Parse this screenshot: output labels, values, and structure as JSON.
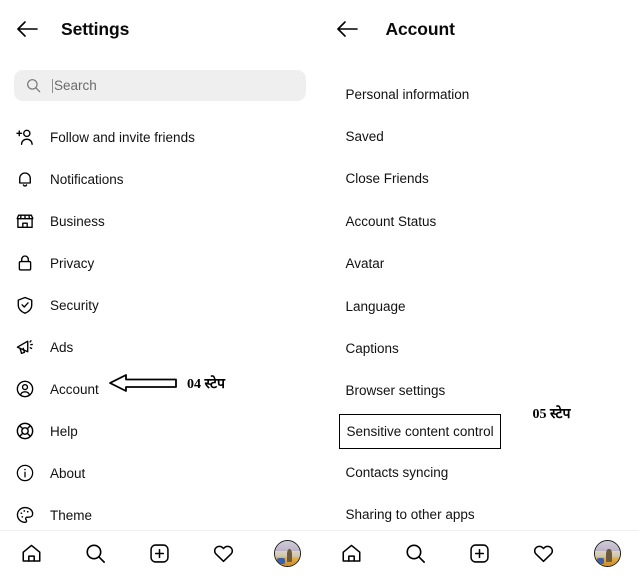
{
  "left_panel": {
    "back_icon": "arrow-left-icon",
    "title": "Settings",
    "search": {
      "icon": "search-icon",
      "placeholder": "Search",
      "value": ""
    },
    "items": [
      {
        "icon": "person-add-icon",
        "label": "Follow and invite friends"
      },
      {
        "icon": "bell-icon",
        "label": "Notifications"
      },
      {
        "icon": "storefront-icon",
        "label": "Business"
      },
      {
        "icon": "lock-icon",
        "label": "Privacy"
      },
      {
        "icon": "shield-check-icon",
        "label": "Security"
      },
      {
        "icon": "megaphone-icon",
        "label": "Ads"
      },
      {
        "icon": "account-circle-icon",
        "label": "Account"
      },
      {
        "icon": "lifebuoy-icon",
        "label": "Help"
      },
      {
        "icon": "info-circle-icon",
        "label": "About"
      },
      {
        "icon": "palette-icon",
        "label": "Theme"
      }
    ],
    "annotation": {
      "icon": "left-arrow-annotation-icon",
      "text": "04 स्टेप"
    }
  },
  "right_panel": {
    "back_icon": "arrow-left-icon",
    "title": "Account",
    "items": [
      {
        "label": "Personal information",
        "highlighted": false
      },
      {
        "label": "Saved",
        "highlighted": false
      },
      {
        "label": "Close Friends",
        "highlighted": false
      },
      {
        "label": "Account Status",
        "highlighted": false
      },
      {
        "label": "Avatar",
        "highlighted": false
      },
      {
        "label": "Language",
        "highlighted": false
      },
      {
        "label": "Captions",
        "highlighted": false
      },
      {
        "label": "Browser settings",
        "highlighted": false
      },
      {
        "label": "Sensitive content control",
        "highlighted": true
      },
      {
        "label": "Contacts syncing",
        "highlighted": false
      },
      {
        "label": "Sharing to other apps",
        "highlighted": false
      }
    ],
    "annotation": {
      "text": "05 स्टेप"
    }
  },
  "bottom_nav": {
    "items": [
      {
        "icon": "home-icon",
        "label": "Home"
      },
      {
        "icon": "search-icon",
        "label": "Search"
      },
      {
        "icon": "plus-square-icon",
        "label": "Create"
      },
      {
        "icon": "heart-icon",
        "label": "Activity"
      },
      {
        "icon": "avatar-icon",
        "label": "Profile"
      }
    ]
  },
  "colors": {
    "background": "#ffffff",
    "text": "#111111",
    "search_field": "#efefef",
    "placeholder": "#6b6b6b",
    "divider": "#f0f0f0",
    "highlight_border": "#000000"
  }
}
